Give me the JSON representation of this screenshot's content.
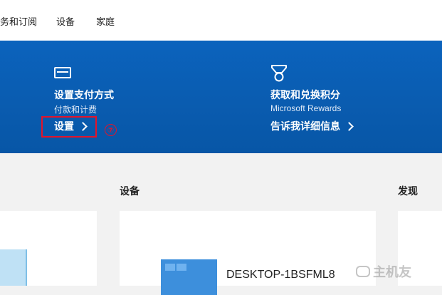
{
  "nav": {
    "items": [
      "务和订阅",
      "设备",
      "家庭"
    ]
  },
  "payment": {
    "icon": "credit-card-icon",
    "title": "设置支付方式",
    "subtitle": "付款和计费",
    "link_label": "设置",
    "step_marker": "⑦"
  },
  "rewards": {
    "icon": "rewards-medal-icon",
    "title": "获取和兑换积分",
    "subtitle": "Microsoft Rewards",
    "link_label": "告诉我详细信息"
  },
  "sections": {
    "devices_title": "设备",
    "discover_title": "发现"
  },
  "device": {
    "name": "DESKTOP-1BSFML8",
    "icon": "windows-pc-icon"
  },
  "watermark": {
    "text": "主机友"
  },
  "colors": {
    "hero_blue": "#0a5cb0",
    "highlight_red": "#e3142a"
  }
}
